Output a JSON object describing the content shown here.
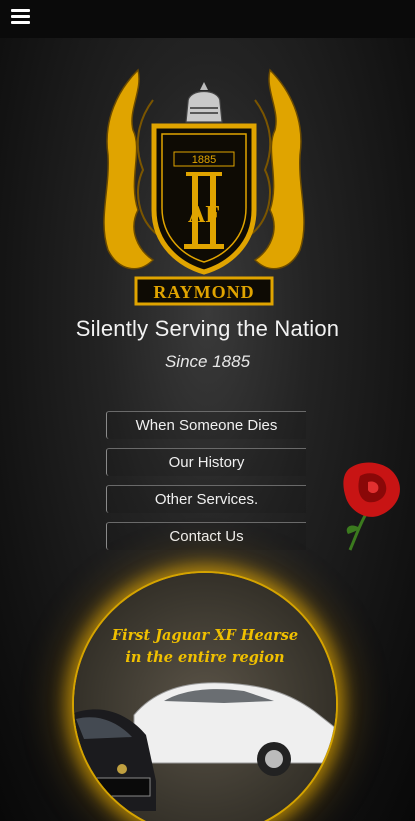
{
  "header": {
    "menu_icon": "hamburger-menu-icon"
  },
  "crest": {
    "year": "1885",
    "initials": "AF",
    "name": "RAYMOND"
  },
  "hero": {
    "tagline": "Silently Serving the Nation",
    "since": "Since 1885"
  },
  "menu": {
    "items": [
      {
        "label": "When Someone Dies"
      },
      {
        "label": "Our History"
      },
      {
        "label": "Other Services."
      },
      {
        "label": "Contact Us"
      }
    ]
  },
  "promo": {
    "line1": "First Jaguar XF Hearse",
    "line2": "in the entire region"
  },
  "colors": {
    "gold": "#e5a800",
    "rose": "#c81414",
    "text": "#f2f2f2"
  }
}
